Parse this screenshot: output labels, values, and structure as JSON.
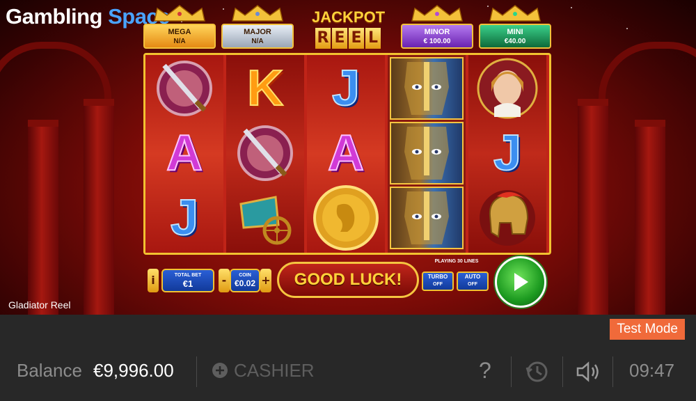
{
  "brand": {
    "logo_white": "Gambling ",
    "logo_blue": "Space"
  },
  "jackpots": [
    {
      "name": "MEGA",
      "value": "N/A",
      "color": "#e8a02a"
    },
    {
      "name": "MAJOR",
      "value": "N/A",
      "color": "#c9d2de"
    },
    {
      "name": "MINOR",
      "value": "€ 100.00",
      "color": "#8a3fd6"
    },
    {
      "name": "MINI",
      "value": "€40.00",
      "color": "#1f9a5a"
    }
  ],
  "title": {
    "line1": "JACKPOT",
    "line2": [
      "R",
      "E",
      "E",
      "L"
    ]
  },
  "reels": [
    [
      "sword-shield",
      "A",
      "J"
    ],
    [
      "K",
      "sword-shield",
      "chariot"
    ],
    [
      "J",
      "A",
      "gold-coin"
    ],
    [
      "gladiator",
      "gladiator",
      "gladiator"
    ],
    [
      "empress",
      "J",
      "helmet"
    ]
  ],
  "controls": {
    "info": "i",
    "total_bet_label": "TOTAL BET",
    "total_bet_value": "€1",
    "minus": "-",
    "coin_label": "COIN",
    "coin_value": "€0.02",
    "plus": "+",
    "message": "GOOD LUCK!",
    "playing_lines": "PLAYING 30 LINES",
    "turbo_label": "TURBO",
    "turbo_state": "OFF",
    "auto_label": "AUTO",
    "auto_state": "OFF"
  },
  "game_name": "Gladiator Reel",
  "bottom_bar": {
    "test_mode": "Test Mode",
    "balance_label": "Balance",
    "balance_value": "€9,996.00",
    "cashier_label": "CASHIER",
    "help": "?",
    "time": "09:47"
  }
}
